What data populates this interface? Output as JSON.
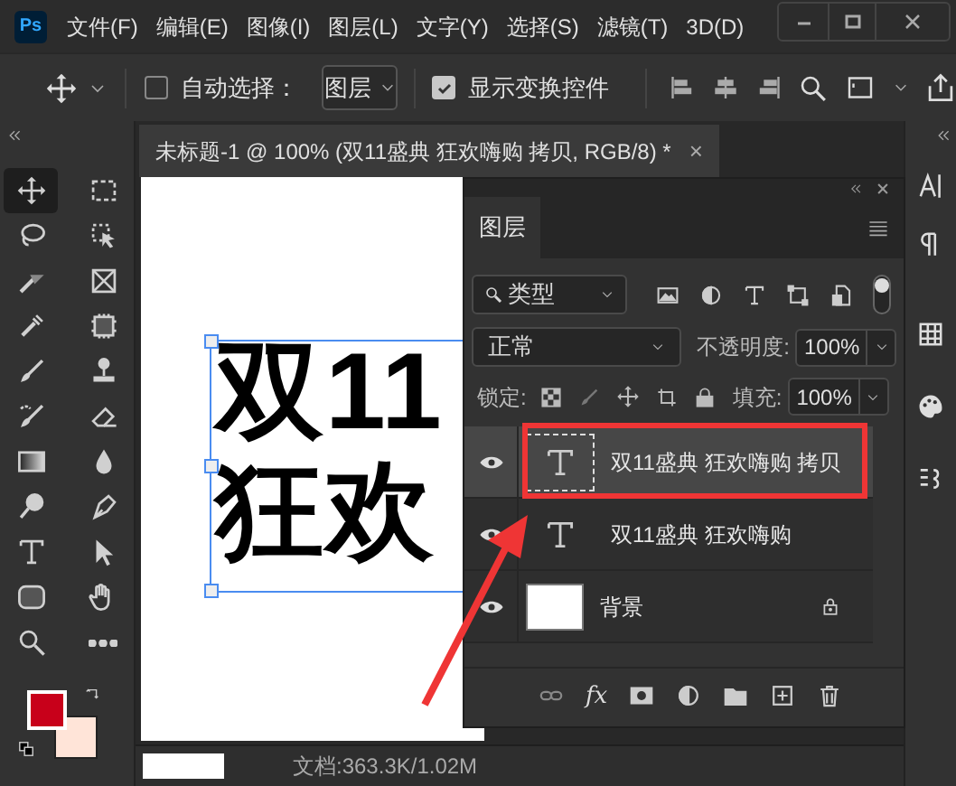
{
  "app": {
    "logo": "Ps"
  },
  "menu": [
    "文件(F)",
    "编辑(E)",
    "图像(I)",
    "图层(L)",
    "文字(Y)",
    "选择(S)",
    "滤镜(T)",
    "3D(D)"
  ],
  "options_bar": {
    "auto_select": {
      "label": "自动选择：",
      "checked": false
    },
    "target": "图层",
    "show_transform": {
      "label": "显示变换控件",
      "checked": true
    }
  },
  "document_tab": {
    "title": "未标题-1 @ 100% (双11盛典 狂欢嗨购 拷贝, RGB/8) *",
    "close": "×"
  },
  "canvas": {
    "text_lines": [
      "双11",
      "狂欢"
    ]
  },
  "tools": [
    {
      "kind": "move",
      "selected": true
    },
    {
      "kind": "marquee",
      "selected": false
    },
    {
      "kind": "lasso",
      "selected": false
    },
    {
      "kind": "object-select",
      "selected": false
    },
    {
      "kind": "slice",
      "selected": false
    },
    {
      "kind": "frame",
      "selected": false
    },
    {
      "kind": "eyedropper",
      "selected": false
    },
    {
      "kind": "chip",
      "selected": false
    },
    {
      "kind": "brush",
      "selected": false
    },
    {
      "kind": "stamp",
      "selected": false
    },
    {
      "kind": "history-brush",
      "selected": false
    },
    {
      "kind": "eraser",
      "selected": false
    },
    {
      "kind": "gradient",
      "selected": false
    },
    {
      "kind": "drop",
      "selected": false
    },
    {
      "kind": "dodge",
      "selected": false
    },
    {
      "kind": "pen",
      "selected": false
    },
    {
      "kind": "type",
      "selected": false
    },
    {
      "kind": "path-select",
      "selected": false
    },
    {
      "kind": "shape",
      "selected": false
    },
    {
      "kind": "hand",
      "selected": false
    },
    {
      "kind": "zoom",
      "selected": false
    },
    {
      "kind": "more",
      "selected": false
    }
  ],
  "swatches": [
    {
      "kind": "foreground",
      "color": "#c8001a"
    },
    {
      "kind": "background",
      "color": "#ffe4d8"
    }
  ],
  "layers_panel": {
    "tab": "图层",
    "filter": "类型",
    "blend_mode": "正常",
    "opacity_label": "不透明度:",
    "opacity": "100%",
    "lock_label": "锁定:",
    "fill_label": "填充:",
    "fill": "100%",
    "footer_fx": "fx",
    "layers": [
      {
        "name": "双11盛典 狂欢嗨购 拷贝",
        "kind": "text",
        "selected": true,
        "highlighted": true,
        "visible": true,
        "locked": false
      },
      {
        "name": "双11盛典 狂欢嗨购",
        "kind": "text",
        "selected": false,
        "highlighted": false,
        "visible": true,
        "locked": false
      },
      {
        "name": "背景",
        "kind": "image",
        "selected": false,
        "highlighted": false,
        "visible": true,
        "locked": true
      }
    ]
  },
  "status_bar": {
    "doc_info": "文档:363.3K/1.02M"
  }
}
